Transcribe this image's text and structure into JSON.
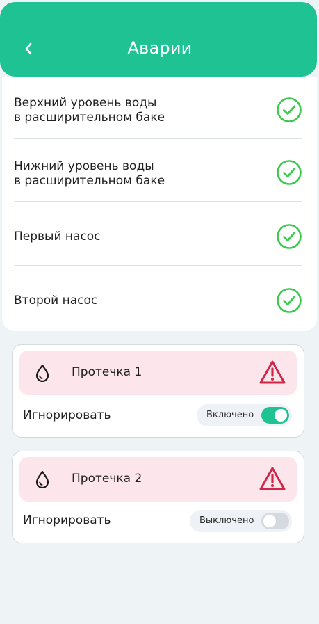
{
  "header": {
    "title": "Аварии",
    "back_icon": "chevron-left-icon",
    "color": "#1fc293"
  },
  "checks": [
    {
      "label_line1": "Верхний уровень воды",
      "label_line2": "в расширительном баке",
      "status": "ok"
    },
    {
      "label_line1": "Нижний уровень воды",
      "label_line2": "в расширительном баке",
      "status": "ok"
    },
    {
      "label_line1": "Первый насос",
      "label_line2": "",
      "status": "ok"
    },
    {
      "label_line1": "Второй насос",
      "label_line2": "",
      "status": "ok"
    }
  ],
  "leaks": [
    {
      "title": "Протечка 1",
      "ignore_label": "Игнорировать",
      "toggle_label": "Включено",
      "toggle_on": true
    },
    {
      "title": "Протечка 2",
      "ignore_label": "Игнорировать",
      "toggle_label": "Выключено",
      "toggle_on": false
    }
  ],
  "colors": {
    "ok_green": "#3cc84e",
    "alert_red": "#d0264a",
    "alert_bg": "#fde6eb",
    "accent": "#1fc293"
  },
  "icons": {
    "check": "check-circle-icon",
    "drop": "water-drop-icon",
    "warning": "warning-triangle-icon"
  }
}
